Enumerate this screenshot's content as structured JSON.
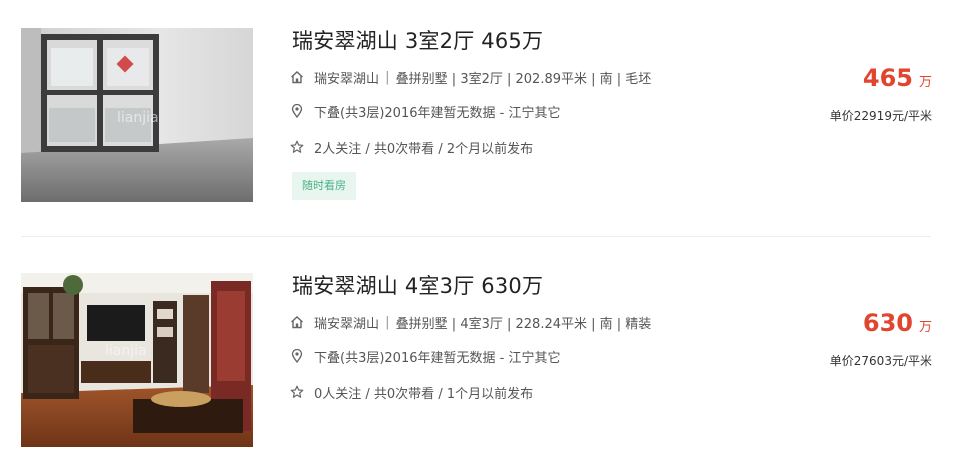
{
  "listings": [
    {
      "title": "瑞安翠湖山 3室2厅 465万",
      "community": "瑞安翠湖山",
      "house_info": "叠拼别墅 | 3室2厅 | 202.89平米 | 南 | 毛坯",
      "position_info": "下叠(共3层)2016年建暂无数据 - 江宁其它",
      "follow_info": "2人关注 / 共0次带看 / 2个月以前发布",
      "tag": "随时看房",
      "total_price": "465",
      "price_unit": "万",
      "unit_price": "单价22919元/平米",
      "watermark": "lianjia"
    },
    {
      "title": "瑞安翠湖山 4室3厅 630万",
      "community": "瑞安翠湖山",
      "house_info": "叠拼别墅 | 4室3厅 | 228.24平米 | 南 | 精装",
      "position_info": "下叠(共3层)2016年建暂无数据 - 江宁其它",
      "follow_info": "0人关注 / 共0次带看 / 1个月以前发布",
      "total_price": "630",
      "price_unit": "万",
      "unit_price": "单价27603元/平米",
      "watermark": "lianjia"
    }
  ],
  "icons": {
    "house": "house-icon",
    "location": "location-pin-icon",
    "star": "star-icon"
  },
  "colors": {
    "price": "#e2452f",
    "tag_bg": "#e8f6ef",
    "tag_text": "#4cb08a"
  }
}
